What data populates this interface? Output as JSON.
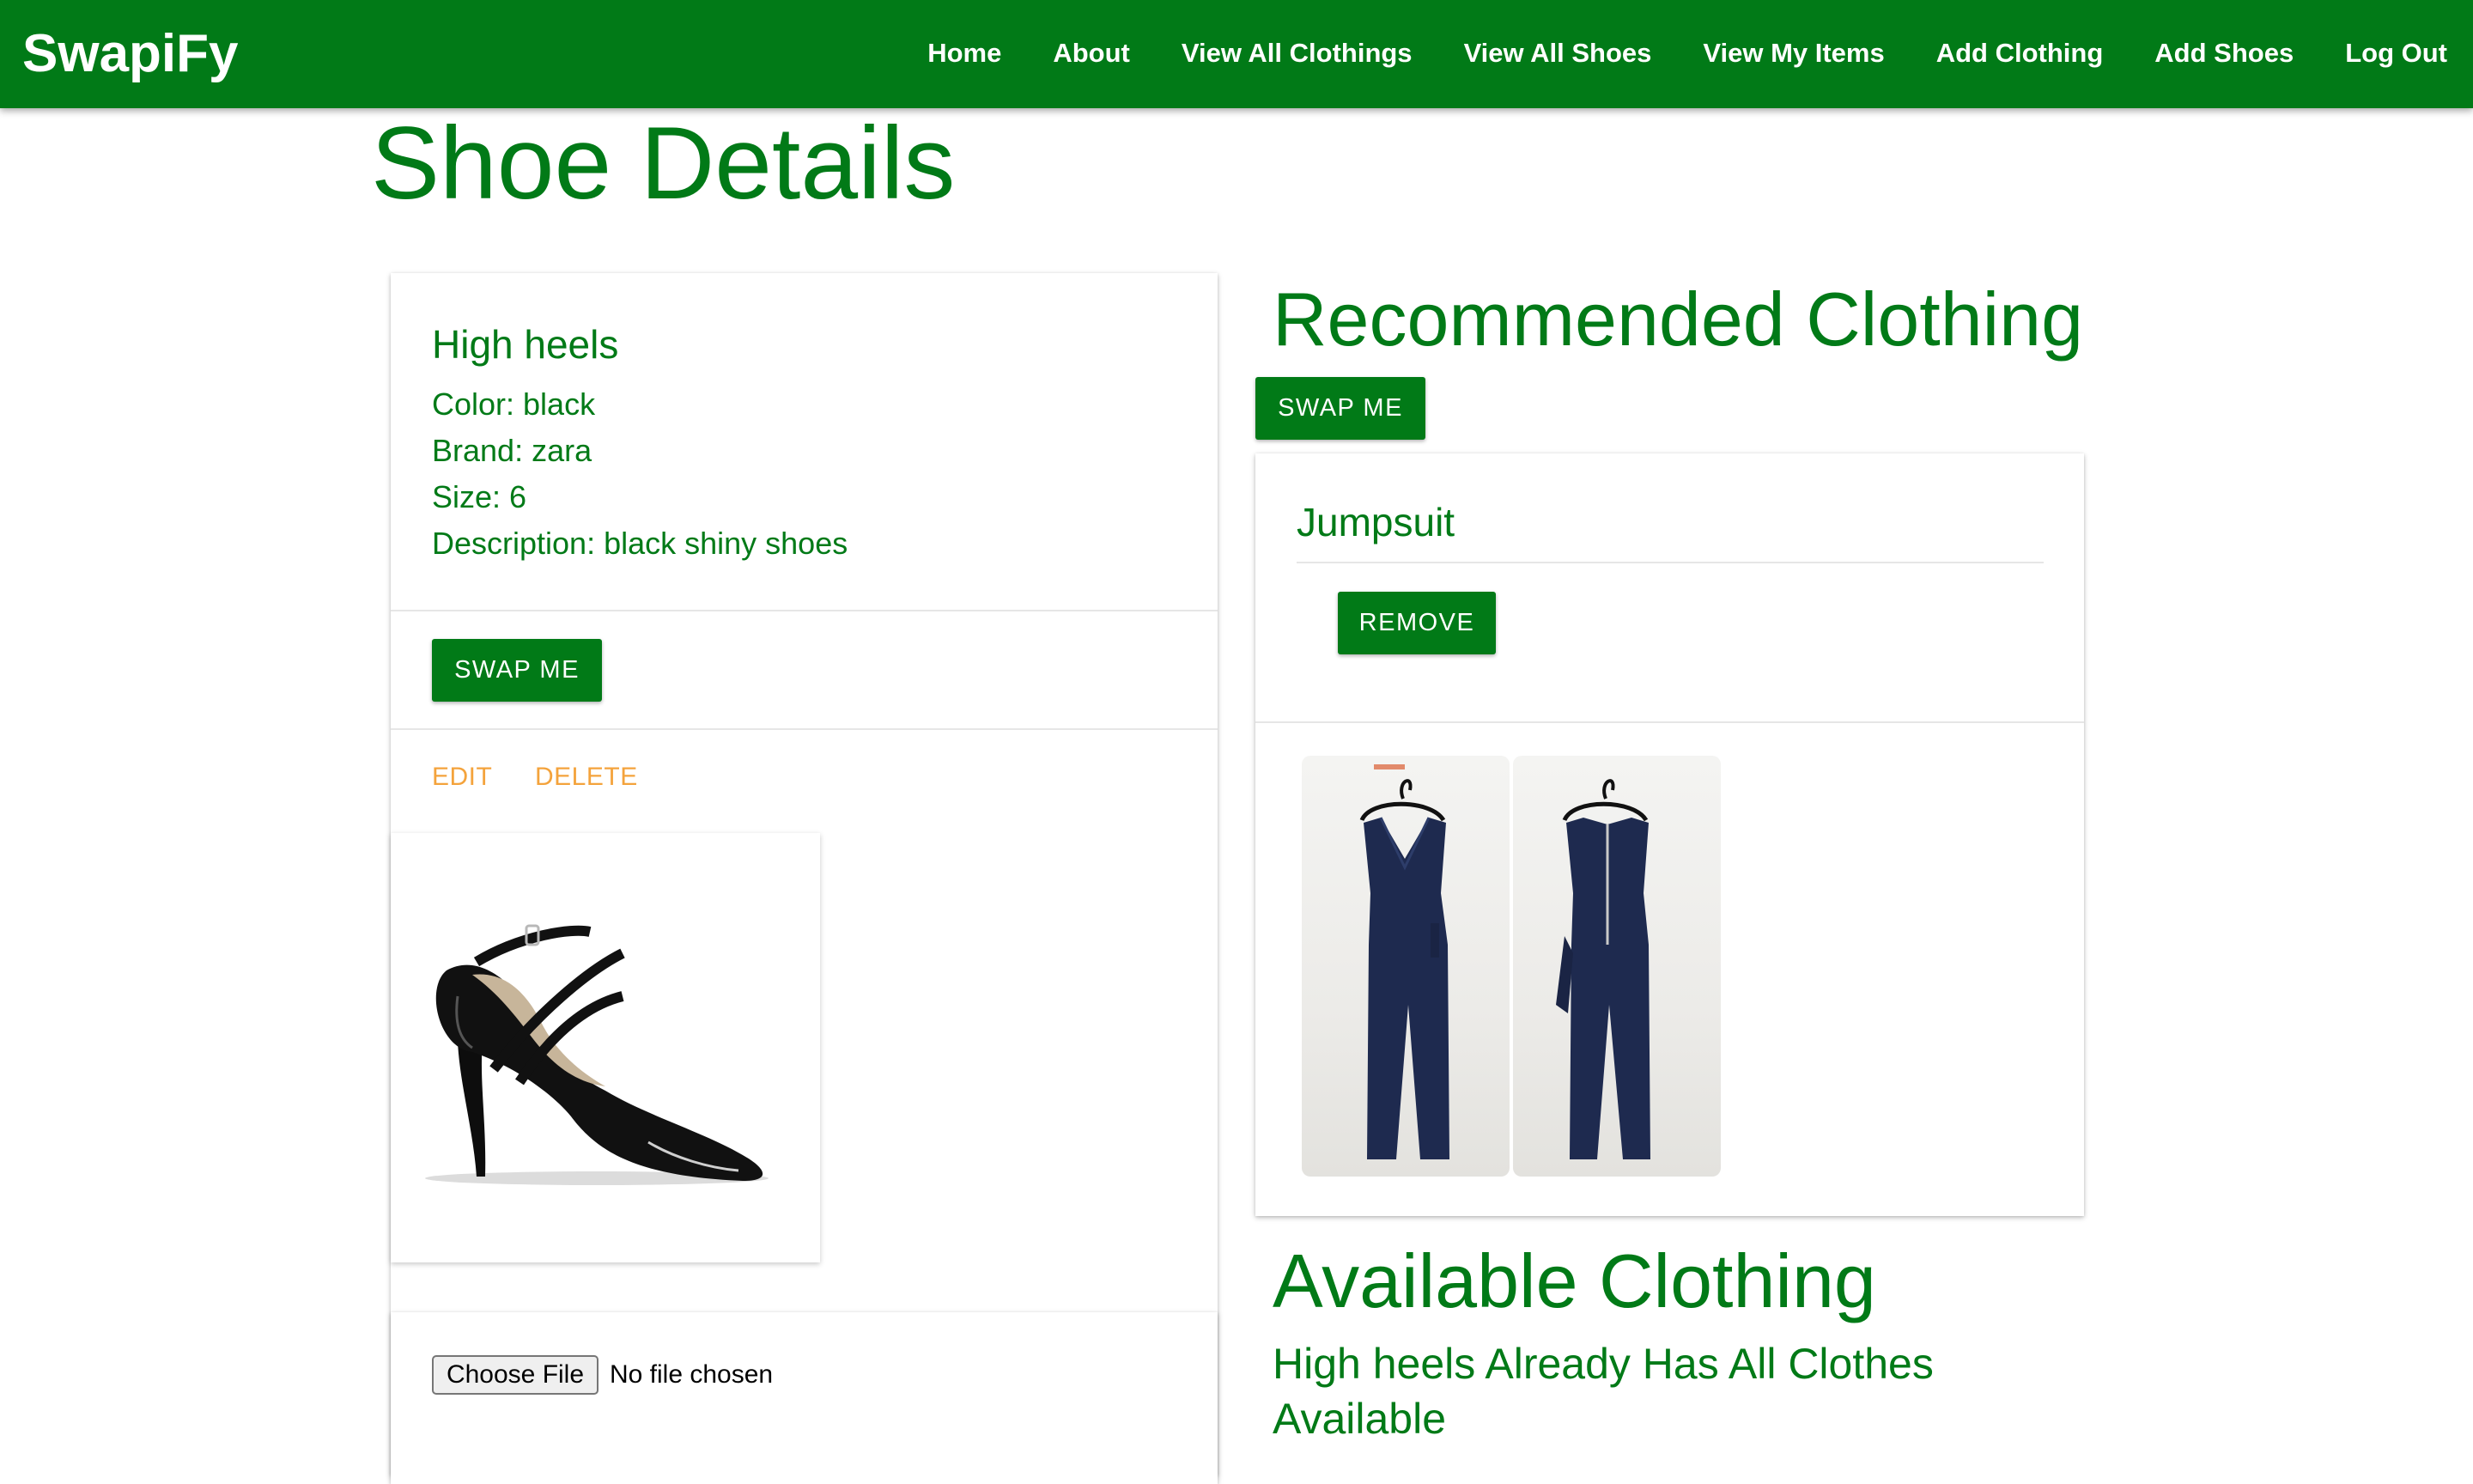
{
  "brand": "SwapiFy",
  "nav": [
    "Home",
    "About",
    "View All Clothings",
    "View All Shoes",
    "View My Items",
    "Add Clothing",
    "Add Shoes",
    "Log Out"
  ],
  "page_title": "Shoe Details",
  "shoe": {
    "name": "High heels",
    "color_text": "Color: black",
    "brand_text": "Brand: zara",
    "size_text": "Size: 6",
    "description_text": "Description: black shiny shoes",
    "swap_label": "SWAP ME",
    "edit_label": "EDIT",
    "delete_label": "DELETE"
  },
  "upload": {
    "choose_label": "Choose File",
    "status": "No file chosen"
  },
  "recommended": {
    "title": "Recommended Clothing",
    "swap_label": "SWAP ME",
    "item_name": "Jumpsuit",
    "remove_label": "REMOVE"
  },
  "available": {
    "title": "Available Clothing",
    "message": "High heels Already Has All Clothes Available"
  },
  "colors": {
    "primary_green": "#017a17",
    "accent_orange": "#f4a33c",
    "jumpsuit_navy": "#1e2a4f"
  }
}
